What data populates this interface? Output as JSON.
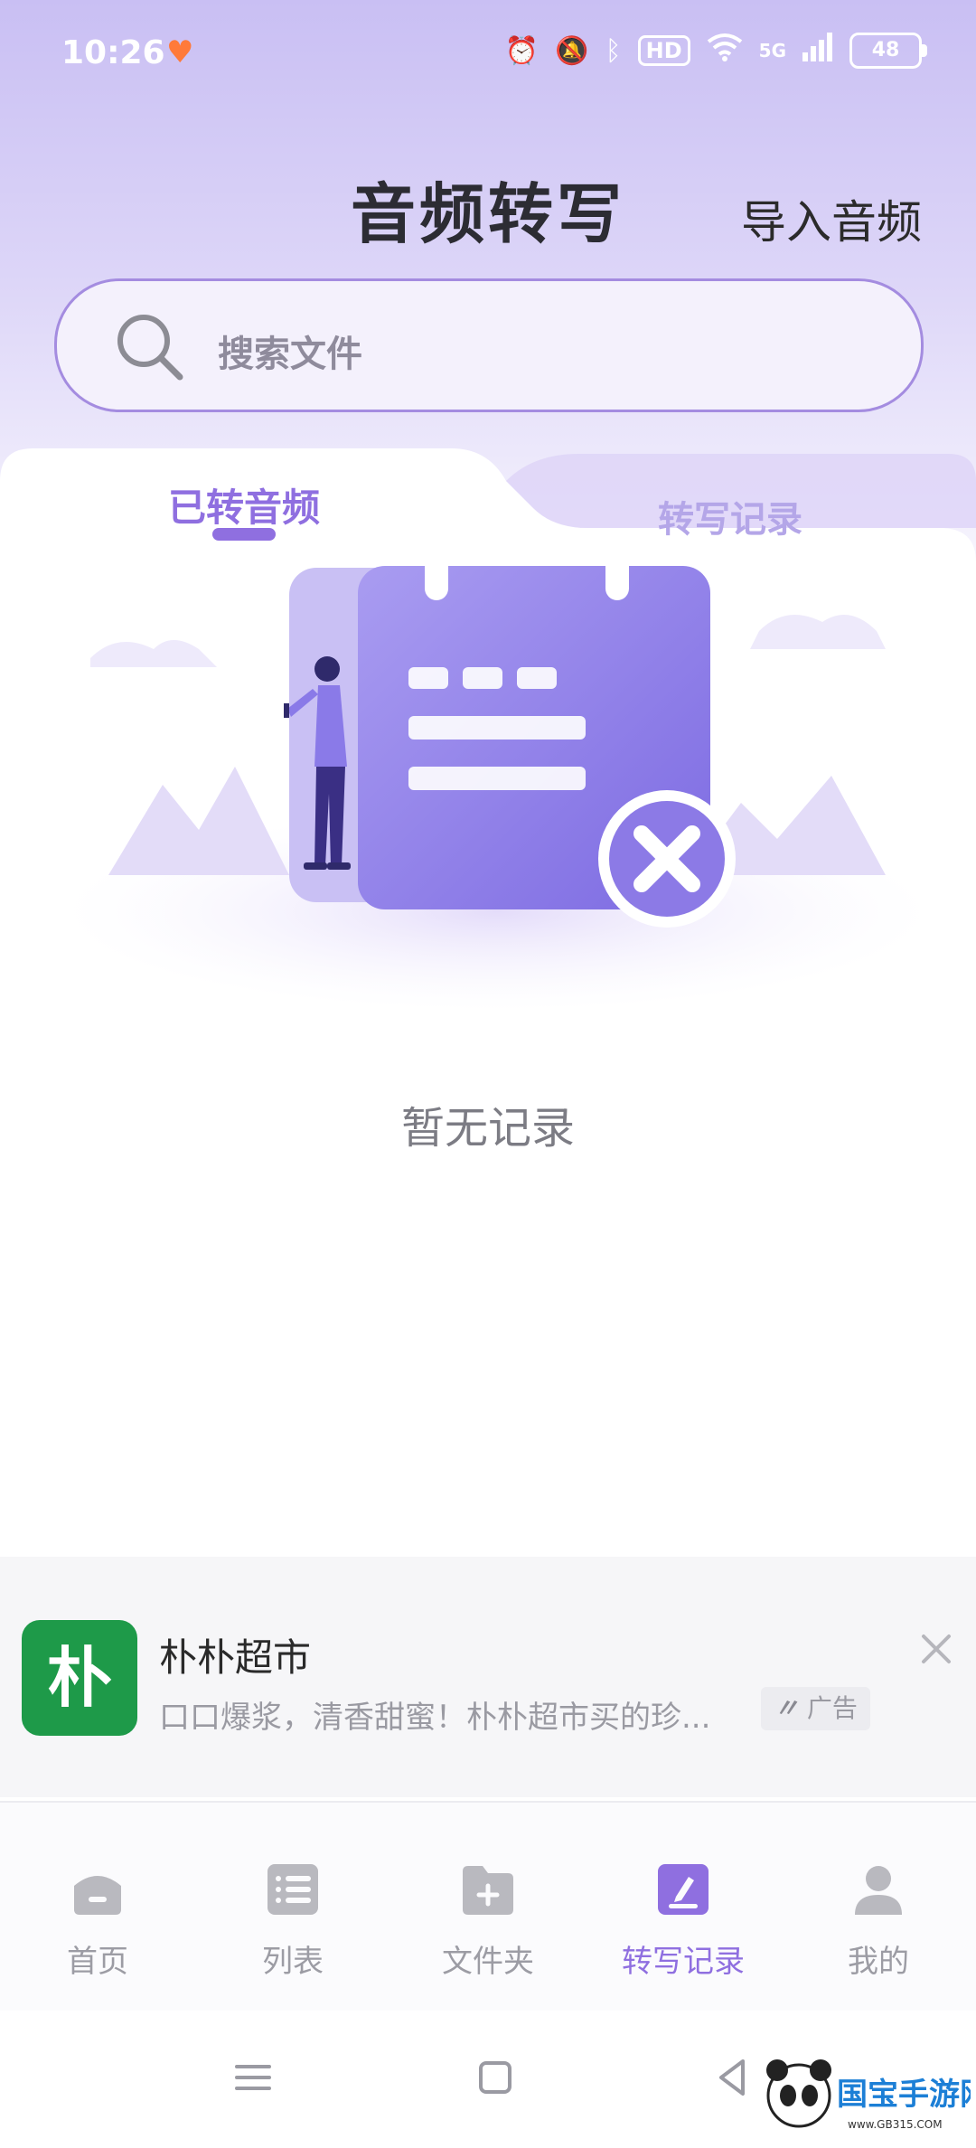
{
  "status_bar": {
    "time": "10:26",
    "hd_badge": "HD",
    "network": "5G",
    "battery": "48"
  },
  "header": {
    "title": "音频转写",
    "import_label": "导入音频"
  },
  "search": {
    "placeholder": "搜索文件"
  },
  "tabs": [
    {
      "label": "已转音频",
      "active": true
    },
    {
      "label": "转写记录",
      "active": false
    }
  ],
  "empty_state": {
    "text": "暂无记录"
  },
  "ad": {
    "logo_char": "朴",
    "name": "朴朴超市",
    "description": "口口爆浆，清香甜蜜！朴朴超市买的珍...",
    "tag": "广告"
  },
  "bottom_nav": [
    {
      "label": "首页",
      "icon": "home-icon",
      "active": false
    },
    {
      "label": "列表",
      "icon": "list-icon",
      "active": false
    },
    {
      "label": "文件夹",
      "icon": "folder-add-icon",
      "active": false
    },
    {
      "label": "转写记录",
      "icon": "edit-note-icon",
      "active": true
    },
    {
      "label": "我的",
      "icon": "user-icon",
      "active": false
    }
  ],
  "colors": {
    "accent": "#8f6fe0",
    "header_gradient_top": "#c9bff3",
    "ad_logo_bg": "#1e9a49",
    "nav_inactive": "#9c9ca4"
  }
}
